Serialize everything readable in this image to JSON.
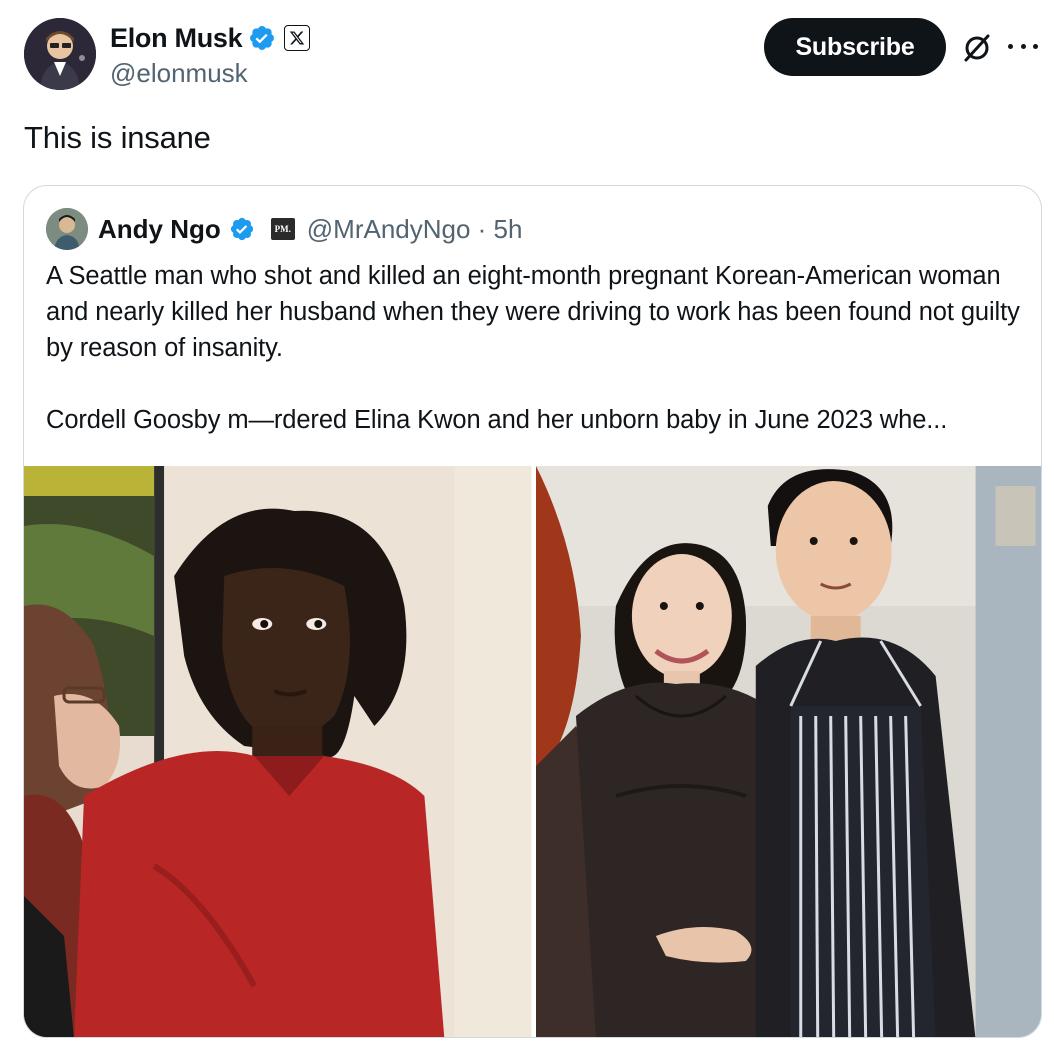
{
  "author": {
    "display_name": "Elon Musk",
    "handle": "@elonmusk",
    "avatar_icon": "avatar-icon",
    "verified_icon": "verified-badge-icon",
    "affiliation_icon": "x-logo-icon"
  },
  "actions": {
    "subscribe_label": "Subscribe",
    "grok_icon": "grok-icon",
    "more_icon": "more-options-icon"
  },
  "tweet": {
    "text": "This is insane"
  },
  "quoted_tweet": {
    "display_name": "Andy Ngo",
    "affiliation_label": "PM.",
    "handle_time": "@MrAndyNgo · 5h",
    "paragraph_1": "A Seattle man who shot and killed an eight-month pregnant Korean-American woman and nearly killed her husband when they were driving to work has been found not guilty by reason of insanity.",
    "paragraph_2": "Cordell Goosby m—rdered Elina Kwon and her unborn baby in June 2023 whe...",
    "media": [
      {
        "icon": "photo-courtroom"
      },
      {
        "icon": "photo-couple"
      }
    ]
  },
  "colors": {
    "text_primary": "#0f1419",
    "text_secondary": "#536471",
    "verified_blue": "#1d9bf0",
    "border": "#cfd9de",
    "button_bg": "#0f1419"
  }
}
